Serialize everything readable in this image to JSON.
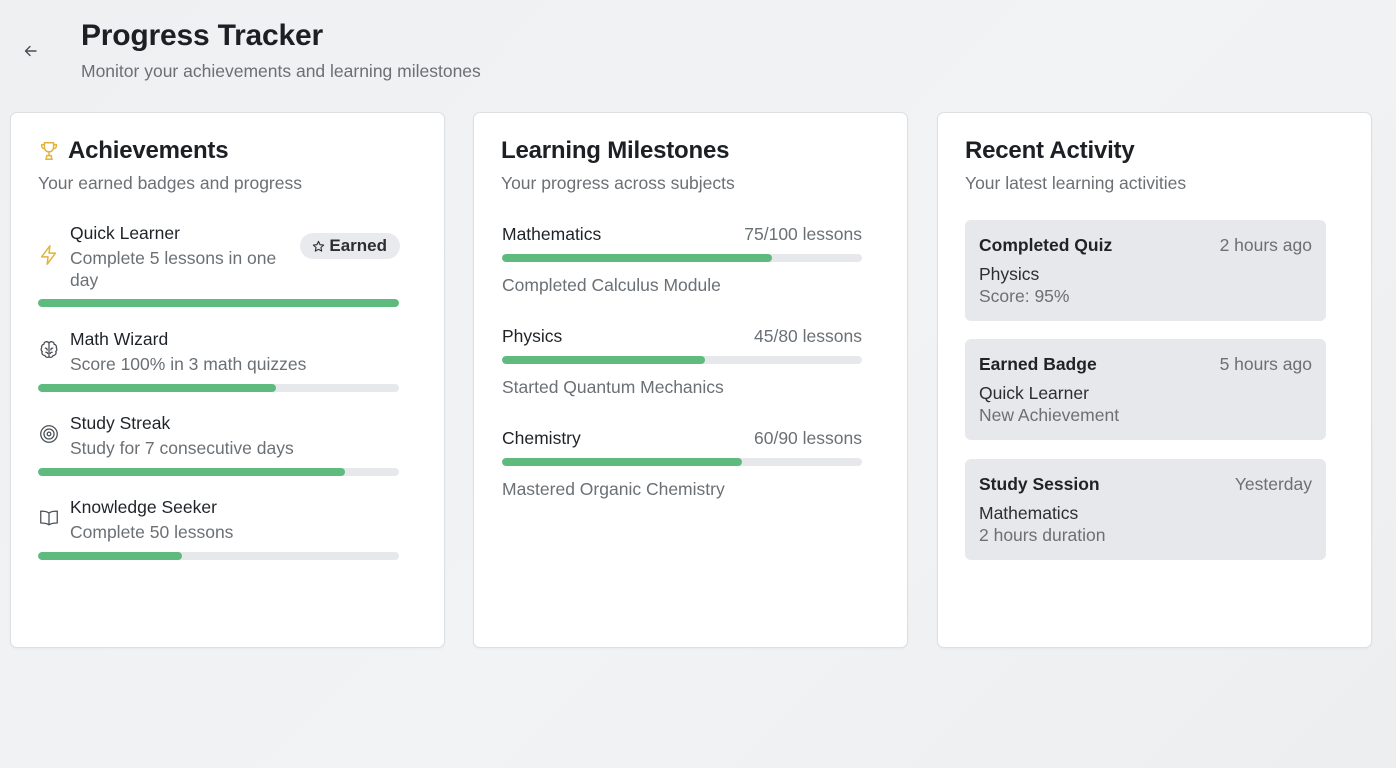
{
  "header": {
    "title": "Progress Tracker",
    "subtitle": "Monitor your achievements and learning milestones",
    "back_icon": "arrow-left-icon"
  },
  "achievements": {
    "title": "Achievements",
    "subtitle": "Your earned badges and progress",
    "title_icon": "trophy-icon",
    "accent_color": "#e2b23a",
    "items": [
      {
        "name": "Quick Learner",
        "description": "Complete 5 lessons in one day",
        "icon": "lightning-icon",
        "progress": 1.0,
        "badge": "Earned",
        "badge_icon": "star-icon"
      },
      {
        "name": "Math Wizard",
        "description": "Score 100% in 3 math quizzes",
        "icon": "brain-icon",
        "progress": 0.66
      },
      {
        "name": "Study Streak",
        "description": "Study for 7 consecutive days",
        "icon": "target-icon",
        "progress": 0.85
      },
      {
        "name": "Knowledge Seeker",
        "description": "Complete 50 lessons",
        "icon": "book-icon",
        "progress": 0.4
      }
    ]
  },
  "milestones": {
    "title": "Learning Milestones",
    "subtitle": "Your progress across subjects",
    "items": [
      {
        "subject": "Mathematics",
        "count": "75/100 lessons",
        "progress": 0.75,
        "note": "Completed Calculus Module"
      },
      {
        "subject": "Physics",
        "count": "45/80 lessons",
        "progress": 0.5625,
        "note": "Started Quantum Mechanics"
      },
      {
        "subject": "Chemistry",
        "count": "60/90 lessons",
        "progress": 0.6667,
        "note": "Mastered Organic Chemistry"
      }
    ]
  },
  "activity": {
    "title": "Recent Activity",
    "subtitle": "Your latest learning activities",
    "items": [
      {
        "title": "Completed Quiz",
        "time": "2 hours ago",
        "subject": "Physics",
        "detail": "Score: 95%"
      },
      {
        "title": "Earned Badge",
        "time": "5 hours ago",
        "subject": "Quick Learner",
        "detail": "New Achievement"
      },
      {
        "title": "Study Session",
        "time": "Yesterday",
        "subject": "Mathematics",
        "detail": "2 hours duration"
      }
    ]
  },
  "colors": {
    "progress_fill": "#5fba7d",
    "progress_track": "#e6e8eb",
    "card_bg": "#ffffff",
    "activity_bg": "#e6e8eb"
  }
}
